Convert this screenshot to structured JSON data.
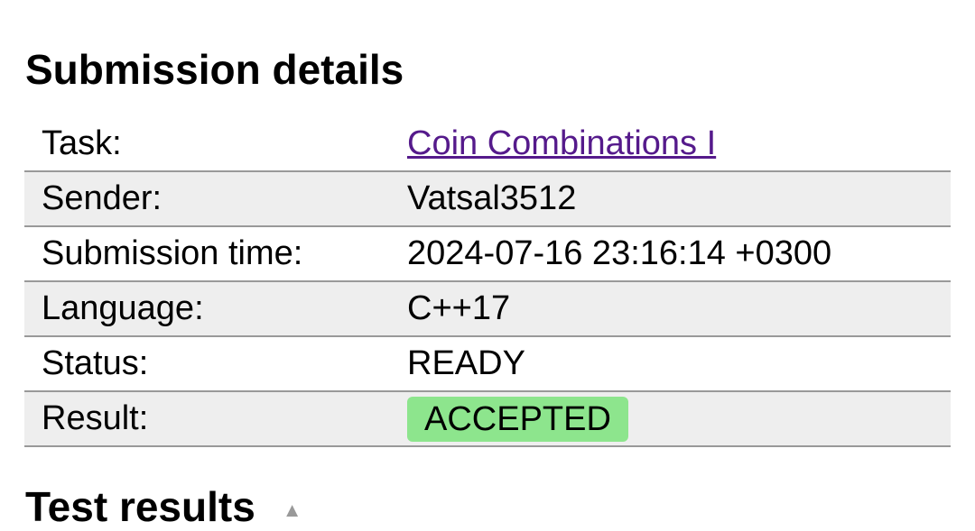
{
  "title": "Submission details",
  "rows": [
    {
      "label": "Task:",
      "value": "Coin Combinations I"
    },
    {
      "label": "Sender:",
      "value": "Vatsal3512"
    },
    {
      "label": "Submission time:",
      "value": "2024-07-16 23:16:14 +0300"
    },
    {
      "label": "Language:",
      "value": "C++17"
    },
    {
      "label": "Status:",
      "value": "READY"
    },
    {
      "label": "Result:",
      "value": "ACCEPTED"
    }
  ],
  "colors": {
    "accepted": "#8de58d",
    "link": "#551a8b"
  },
  "test_results": {
    "title": "Test results",
    "toggle_icon": "triangle-up-icon"
  }
}
